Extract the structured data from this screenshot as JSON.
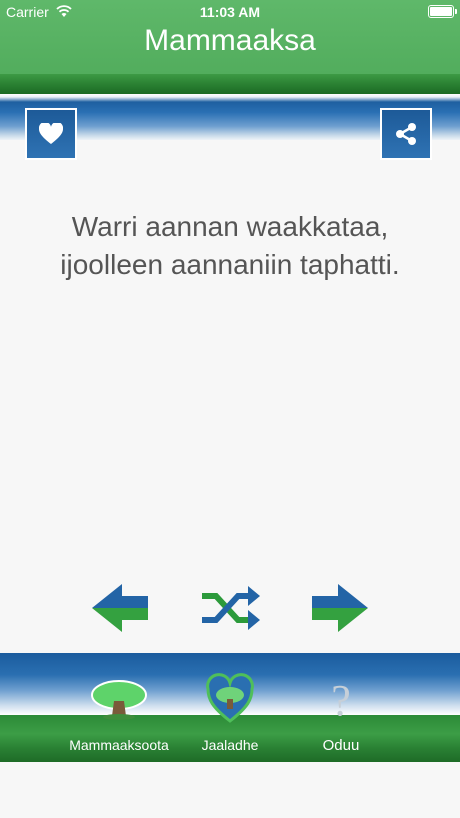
{
  "status_bar": {
    "carrier": "Carrier",
    "time": "11:03 AM"
  },
  "header": {
    "title": "Mammaaksa"
  },
  "actions": {
    "favorite_icon": "heart-icon",
    "share_icon": "share-icon"
  },
  "proverb": {
    "line1": "Warri aannan waakkataa,",
    "line2": "ijoolleen aannaniin taphatti."
  },
  "navigation": {
    "prev_icon": "arrow-left-icon",
    "shuffle_icon": "shuffle-icon",
    "next_icon": "arrow-right-icon"
  },
  "tabs": [
    {
      "label": "Mammaaksoota",
      "icon": "tree-icon"
    },
    {
      "label": "Jaaladhe",
      "icon": "heart-tree-icon"
    },
    {
      "label": "Oduu",
      "icon": "question-icon"
    }
  ],
  "colors": {
    "green": "#52ad5d",
    "blue": "#1e5fa0",
    "text": "#555555"
  }
}
